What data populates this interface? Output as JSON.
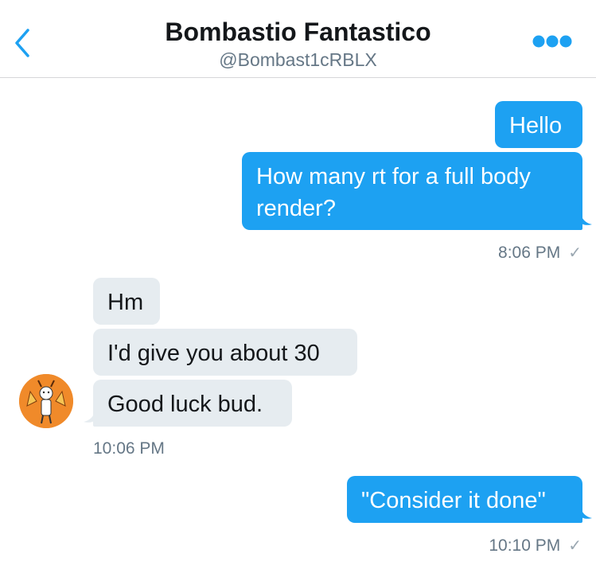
{
  "header": {
    "title": "Bombastio Fantastico",
    "handle": "@Bombast1cRBLX",
    "back_icon": "chevron-left-icon",
    "more_icon": "more-dots-icon"
  },
  "messages": [
    {
      "side": "out",
      "text": "Hello"
    },
    {
      "side": "out",
      "text": "How many rt for a full body render?"
    },
    {
      "side": "in",
      "text": "Hm"
    },
    {
      "side": "in",
      "text": "I'd give you about 30"
    },
    {
      "side": "in",
      "text": "Good luck bud."
    },
    {
      "side": "out",
      "text": "\"Consider it done\""
    }
  ],
  "timestamps": {
    "first": "8:06 PM",
    "second": "10:06 PM",
    "third": "10:10 PM",
    "read_mark": "✓"
  },
  "colors": {
    "accent": "#1da1f2",
    "incoming_bubble": "#e6ecf0",
    "avatar_bg": "#f08a2a"
  }
}
